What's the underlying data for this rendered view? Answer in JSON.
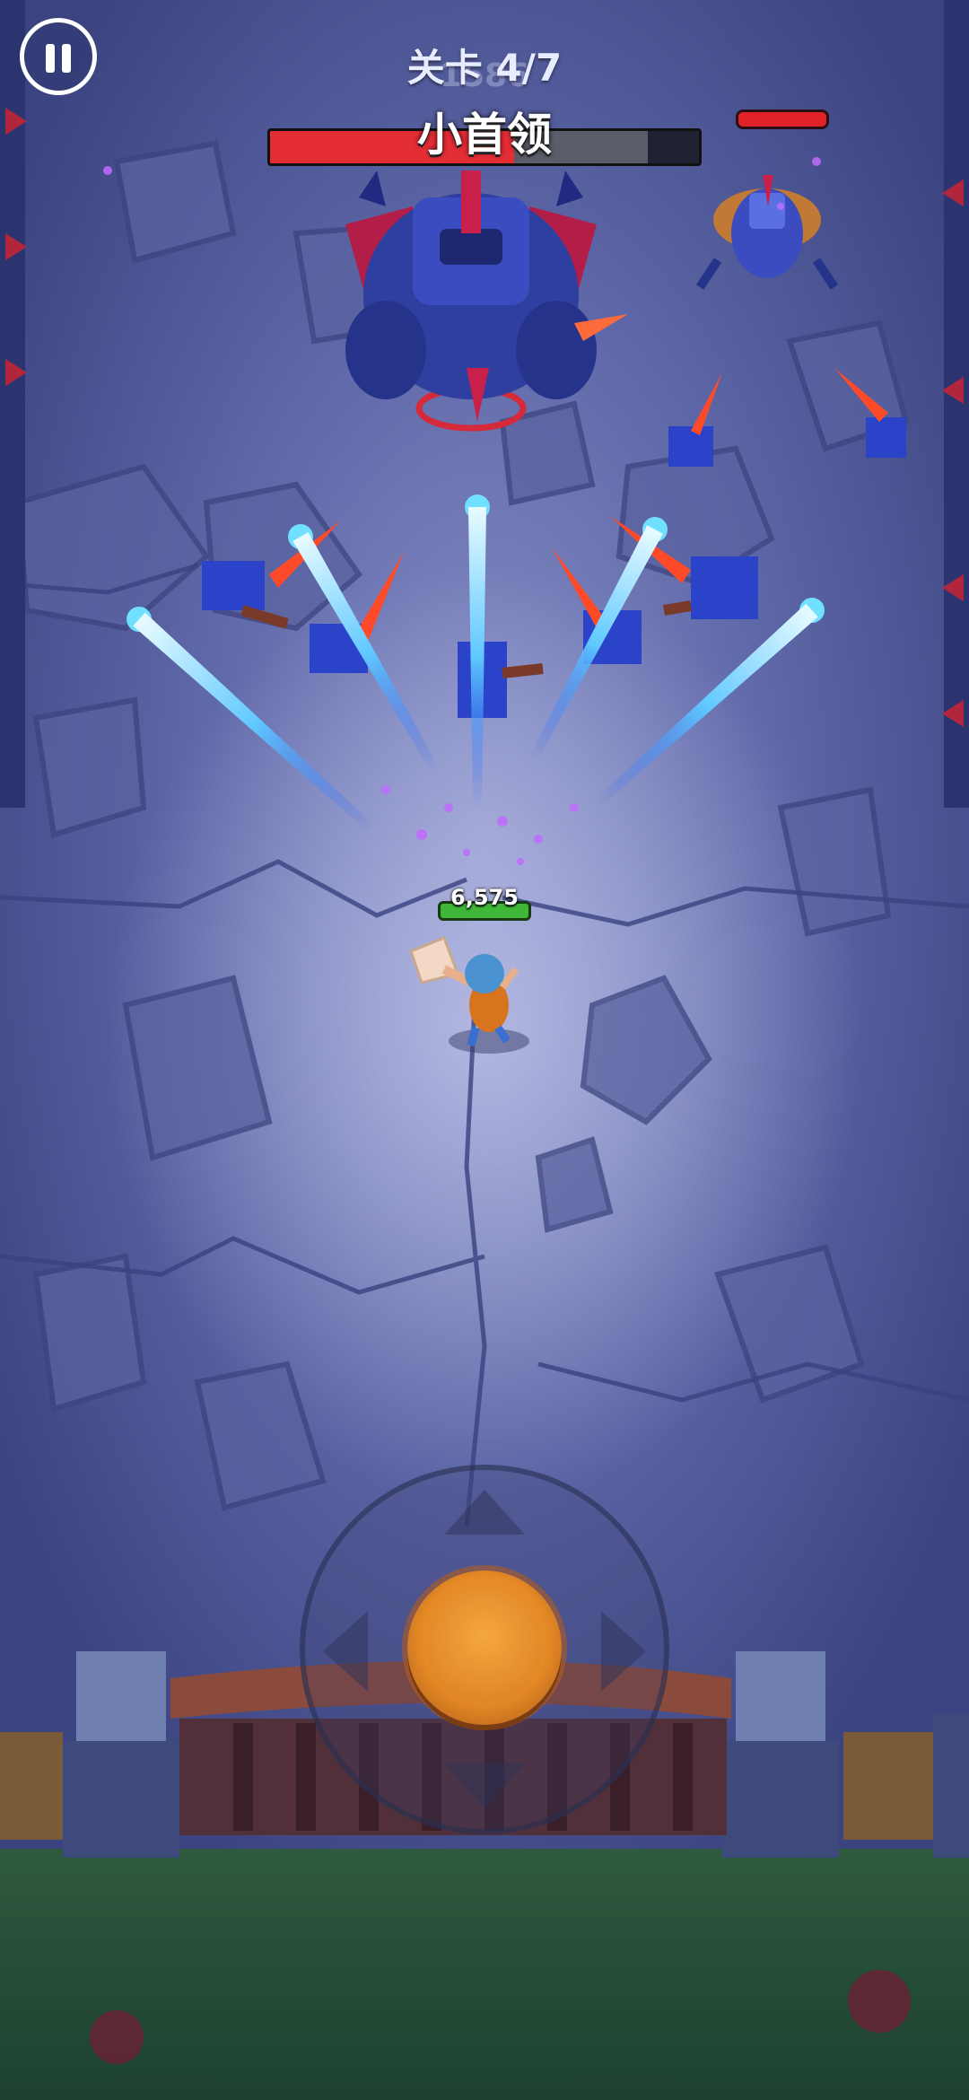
{
  "hud": {
    "level_label": "关卡 4/7",
    "score_ghost": "1586",
    "boss_name": "小首领",
    "boss_health_fraction": 0.57,
    "player_hp_text": "6,575",
    "pause_icon": "pause-icon",
    "joystick_icon": "joystick-icon"
  },
  "colors": {
    "boss_bar": "#e52d35",
    "player_bar": "#3fb83a",
    "joystick": "#e58a25"
  }
}
